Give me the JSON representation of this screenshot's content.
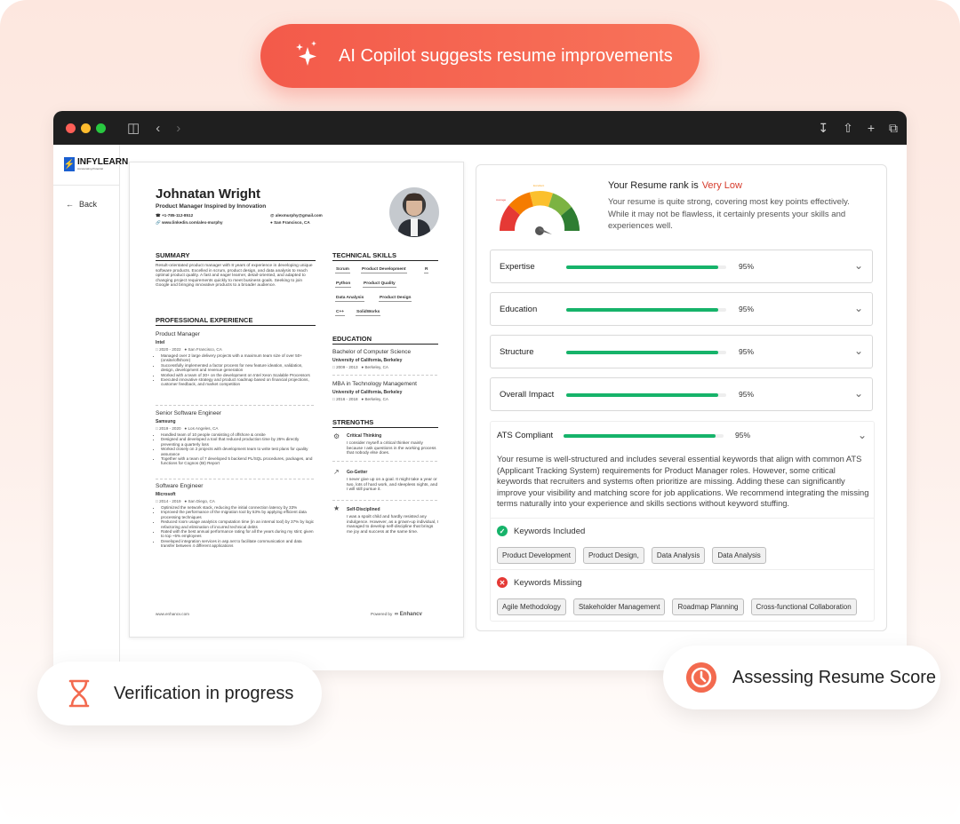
{
  "banner": {
    "text": "AI Copilot suggests resume improvements"
  },
  "sidebar": {
    "logo_name": "INFYLEARN",
    "logo_tag": "Accelerating Potential",
    "back_label": "Back"
  },
  "resume": {
    "name": "Johnatan Wright",
    "title": "Product Manager Inspired by Innovation",
    "phone": "+1-785-112-8512",
    "linkedin": "www.linkedin.com/alex-murphy",
    "email": "alexmurphy@gmail.com",
    "location": "San Francisco, CA",
    "summary_h": "SUMMARY",
    "summary": "Result-orientated product manager with 8 years of experience in developing unique software products. Excelled in scrum, product design, and data analysis to reach optimal product quality. A fast and eager learner, detail-oriented, and adapted to changing project requirements quickly to meet business goals. Seeking to join Google and bringing innovative products to a broader audience.",
    "exp_h": "PROFESSIONAL EXPERIENCE",
    "jobs": [
      {
        "role": "Product Manager",
        "company": "Intel",
        "dates": "2020 - 2022",
        "loc": "San Francisco, CA",
        "bullets": [
          "Managed over 2 large delivery projects with a maximum team size of over 50+ (onsite/offshore)",
          "Successfully implemented a factor process for new feature ideation, validation, design, development and revenue generation",
          "Worked with a team of 30+ on the development on Intel Xeon Scalable Processors",
          "Executed innovative strategy and product roadmap based on financial projections, customer feedback, and market competition"
        ]
      },
      {
        "role": "Senior Software Engineer",
        "company": "Samsung",
        "dates": "2019 - 2020",
        "loc": "Los Angeles, CA",
        "bullets": [
          "Handled team of 10 people consisting of offshore & onsite",
          "Designed and developed a tool that reduced production time by 25% directly preventing a quarterly loss",
          "Worked closely on 2 projects with development team to write test plans for quality assurance",
          "Together with a team of 7 developed 5 backend PL/SQL procedures, packages, and functions for Cognos (BI) Report"
        ]
      },
      {
        "role": "Software Engineer",
        "company": "Microsoft",
        "dates": "2014 - 2019",
        "loc": "San Diego, CA",
        "bullets": [
          "Optimized the network stack, reducing the initial connection latency by 33%",
          "Improved the performance of the migration tool by 53% by applying efficient data processing techniques",
          "Reduced room usage analytics computation time (in an internal tool) by 37% by logic refactoring and elimination of incurred technical debts",
          "Rated with the best annual performance rating for all the years during my stint; given to top ~5% employees",
          "Developed integration services in asp.net to facilitate communication and data transfer between 4 different applications"
        ]
      }
    ],
    "skills_h": "TECHNICAL SKILLS",
    "skills": [
      "Scrum",
      "Product Development",
      "R",
      "Python",
      "Product Quality",
      "Data Analysis",
      "Product Design",
      "C++",
      "SolidWorks"
    ],
    "edu_h": "EDUCATION",
    "edu": [
      {
        "degree": "Bachelor of Computer Science",
        "school": "University of California, Berkeley",
        "dates": "2009 - 2013",
        "loc": "Berkeley, CA"
      },
      {
        "degree": "MBA in Technology Management",
        "school": "University of California, Berkeley",
        "dates": "2016 - 2018",
        "loc": "Berkeley, CA"
      }
    ],
    "strengths_h": "STRENGTHS",
    "strengths": [
      {
        "title": "Critical Thinking",
        "text": "I consider myself a critical thinker mainly because I ask questions in the working process that nobody else does."
      },
      {
        "title": "Go-Getter",
        "text": "I never give up on a goal. It might take a year or two, lots of hard work, and sleepless nights, and I will still pursue it."
      },
      {
        "title": "Self-Disciplined",
        "text": "I was a spoilt child and hardly resisted any indulgence. However, as a grown-up individual, I managed to develop self-discipline that brings me joy and success at the same time."
      }
    ],
    "footer_left": "www.enhancv.com",
    "footer_powered": "Powered by",
    "footer_brand": "Enhancv"
  },
  "panel": {
    "rank_label": "Your Resume rank is",
    "rank_value": "Very Low",
    "rank_desc": "Your resume is quite strong, covering most key points effectively. While it may not be flawless, it certainly presents your skills and experiences well.",
    "gauge_labels": [
      "Average",
      "Excellent"
    ],
    "criteria": [
      {
        "label": "Expertise",
        "pct_text": "95%",
        "pct": 0.95
      },
      {
        "label": "Education",
        "pct_text": "95%",
        "pct": 0.95
      },
      {
        "label": "Structure",
        "pct_text": "95%",
        "pct": 0.95
      },
      {
        "label": "Overall Impact",
        "pct_text": "95%",
        "pct": 0.95
      }
    ],
    "ats": {
      "label": "ATS Compliant",
      "pct_text": "95%",
      "pct": 0.95,
      "desc": "Your resume is well-structured and includes several essential keywords that align with common ATS (Applicant Tracking System) requirements for Product Manager roles. However, some critical keywords that recruiters and systems often prioritize are missing. Adding these can significantly improve your visibility and matching score for job applications. We recommend integrating the missing terms naturally into your experience and skills sections without keyword stuffing.",
      "included_label": "Keywords Included",
      "included": [
        "Product Development",
        "Product Design,",
        "Data Analysis",
        "Data Analysis"
      ],
      "missing_label": "Keywords Missing",
      "missing": [
        "Agile Methodology",
        "Stakeholder Management",
        "Roadmap Planning",
        "Cross-functional Collaboration"
      ]
    }
  },
  "cards": {
    "verification": "Verification in progress",
    "assessing": "Assessing Resume Score"
  },
  "colors": {
    "accent": "#f35a4a",
    "success": "#16b36a",
    "danger": "#e53935"
  }
}
